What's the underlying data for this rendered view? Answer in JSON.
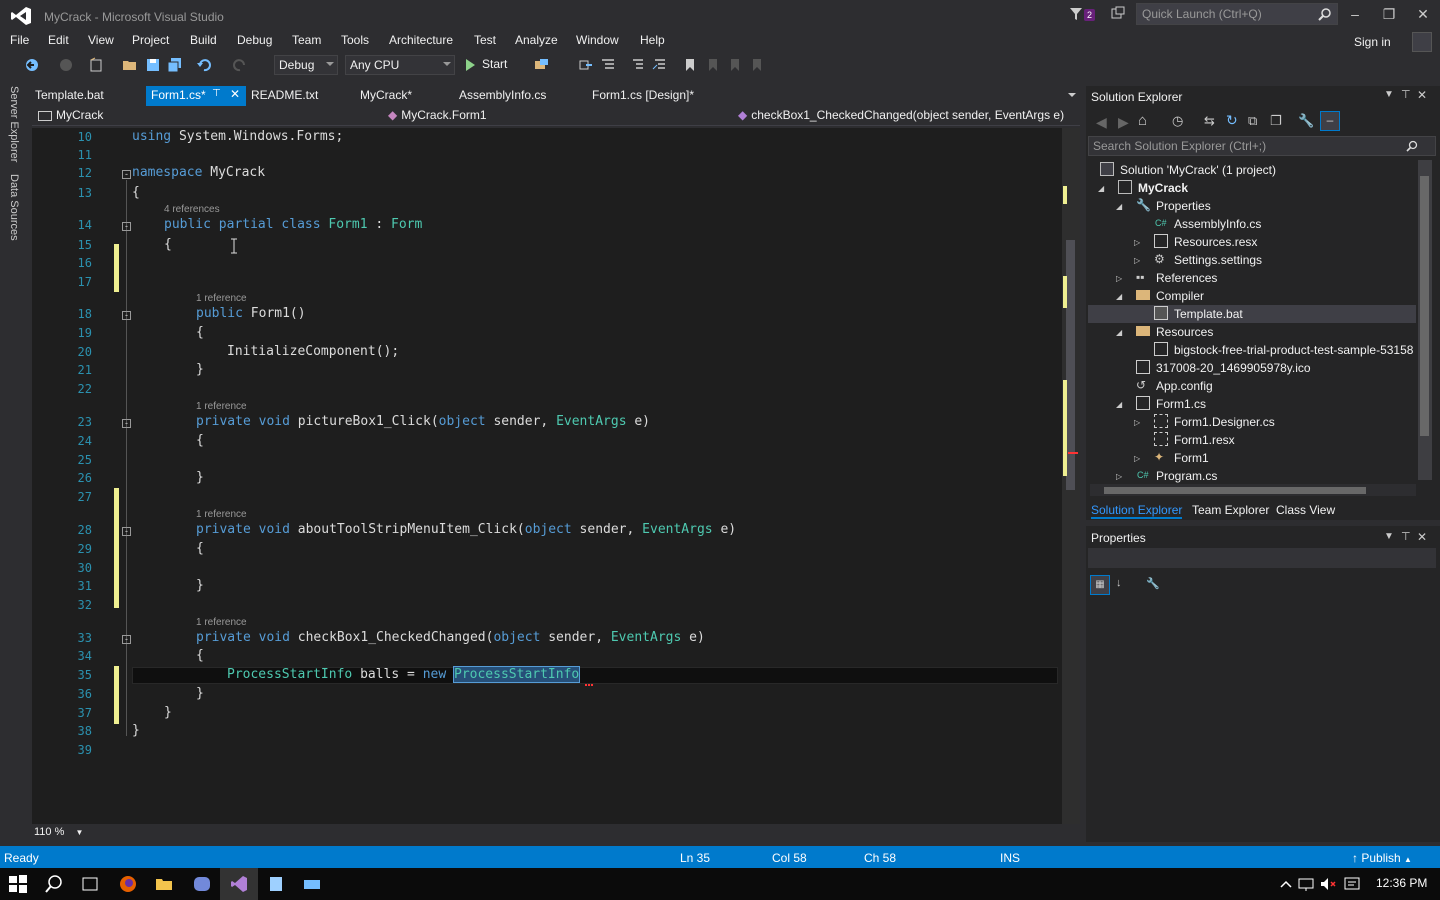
{
  "window": {
    "title": "MyCrack - Microsoft Visual Studio",
    "notification_count": "2",
    "quick_launch_placeholder": "Quick Launch (Ctrl+Q)",
    "sign_in": "Sign in"
  },
  "menu": [
    "File",
    "Edit",
    "View",
    "Project",
    "Build",
    "Debug",
    "Team",
    "Tools",
    "Architecture",
    "Test",
    "Analyze",
    "Window",
    "Help"
  ],
  "toolbar": {
    "config": "Debug",
    "platform": "Any CPU",
    "start": "Start"
  },
  "side_tabs": [
    "Server Explorer",
    "Data Sources"
  ],
  "tabs": [
    "Template.bat",
    "Form1.cs*",
    "README.txt",
    "MyCrack*",
    "AssemblyInfo.cs",
    "Form1.cs [Design]*"
  ],
  "nav": {
    "project": "MyCrack",
    "class": "MyCrack.Form1",
    "member": "checkBox1_CheckedChanged(object sender, EventArgs e)"
  },
  "code": {
    "line_numbers": [
      "10",
      "11",
      "12",
      "13",
      "14",
      "15",
      "16",
      "17",
      "18",
      "19",
      "20",
      "21",
      "22",
      "23",
      "24",
      "25",
      "26",
      "27",
      "28",
      "29",
      "30",
      "31",
      "32",
      "33",
      "34",
      "35",
      "36",
      "37",
      "38",
      "39"
    ],
    "lens": {
      "four": "4 references",
      "one": "1 reference"
    },
    "kw_using": "using",
    "ns_system": "System.Windows.Forms;",
    "kw_namespace": "namespace",
    "ns_name": "MyCrack",
    "brace_open": "{",
    "brace_close": "}",
    "kw_public": "public",
    "kw_partial": "partial",
    "kw_class": "class",
    "class_name": "Form1",
    "colon": ":",
    "base_type": "Form",
    "ctor": "Form1()",
    "init_call": "InitializeComponent();",
    "kw_private": "private",
    "kw_void": "void",
    "kw_object": "object",
    "kw_new": "new",
    "m1": "pictureBox1_Click(",
    "m2": "aboutToolStripMenuItem_Click(",
    "m3": "checkBox1_CheckedChanged(",
    "sender": "sender,",
    "event_args": "EventArgs",
    "e_param": "e)",
    "psi_type": "ProcessStartInfo",
    "psi_var": "balls =",
    "psi_selected": "ProcessStartInfo"
  },
  "editor": {
    "zoom": "110 %"
  },
  "solution_explorer": {
    "title": "Solution Explorer",
    "search_placeholder": "Search Solution Explorer (Ctrl+;)",
    "items": [
      "Solution 'MyCrack' (1 project)",
      "MyCrack",
      "Properties",
      "AssemblyInfo.cs",
      "Resources.resx",
      "Settings.settings",
      "References",
      "Compiler",
      "Template.bat",
      "Resources",
      "bigstock-free-trial-product-test-sample-53158",
      "317008-20_1469905978y.ico",
      "App.config",
      "Form1.cs",
      "Form1.Designer.cs",
      "Form1.resx",
      "Form1",
      "Program.cs"
    ],
    "bottom_tabs": [
      "Solution Explorer",
      "Team Explorer",
      "Class View"
    ]
  },
  "properties": {
    "title": "Properties"
  },
  "status": {
    "ready": "Ready",
    "line": "Ln 35",
    "col": "Col 58",
    "ch": "Ch 58",
    "mode": "INS",
    "publish": "Publish"
  },
  "taskbar": {
    "time": "12:36 PM"
  },
  "colors": {
    "accent": "#007acc",
    "editor_bg": "#1e1e1e",
    "keyword": "#569cd6",
    "type": "#4ec9b0",
    "line_number": "#2b91af",
    "change_marker": "#efef91"
  }
}
